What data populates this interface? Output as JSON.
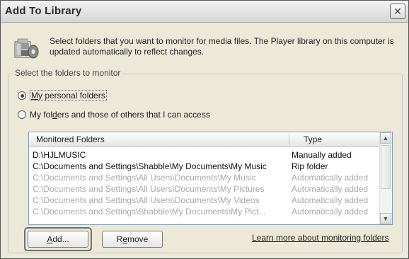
{
  "window": {
    "title": "Add To Library",
    "close_glyph": "✕"
  },
  "header": {
    "icon": "media-library-icon",
    "intro_text": "Select folders that you want to monitor for media files. The Player library on this computer is updated automatically to reflect changes."
  },
  "group": {
    "legend": "Select the folders to monitor",
    "options": [
      {
        "label_prefix": "",
        "mnemonic": "M",
        "label_rest": "y personal folders",
        "selected": true
      },
      {
        "label_prefix": "My fol",
        "mnemonic": "d",
        "label_rest": "ers and those of others that I can access",
        "selected": false
      }
    ]
  },
  "list": {
    "columns": [
      "Monitored Folders",
      "Type"
    ],
    "rows": [
      {
        "folder": "D:\\HJLMUSIC",
        "type": "Manually added",
        "enabled": true
      },
      {
        "folder": "C:\\Documents and Settings\\Shabble\\My Documents\\My Music",
        "type": "Rip folder",
        "enabled": true
      },
      {
        "folder": "C:\\Documents and Settings\\All Users\\Documents\\My Music",
        "type": "Automatically added",
        "enabled": false
      },
      {
        "folder": "C:\\Documents and Settings\\All Users\\Documents\\My Pictures",
        "type": "Automatically added",
        "enabled": false
      },
      {
        "folder": "C:\\Documents and Settings\\All Users\\Documents\\My Videos",
        "type": "Automatically added",
        "enabled": false
      },
      {
        "folder": "C:\\Documents and Settings\\Shabble\\My Documents\\My Pict...",
        "type": "Automatically added",
        "enabled": false
      }
    ]
  },
  "buttons": {
    "add": {
      "mnemonic": "A",
      "rest": "dd..."
    },
    "remove": {
      "prefix": "R",
      "mnemonic": "e",
      "rest": "move"
    }
  },
  "link": "Learn more about monitoring folders"
}
